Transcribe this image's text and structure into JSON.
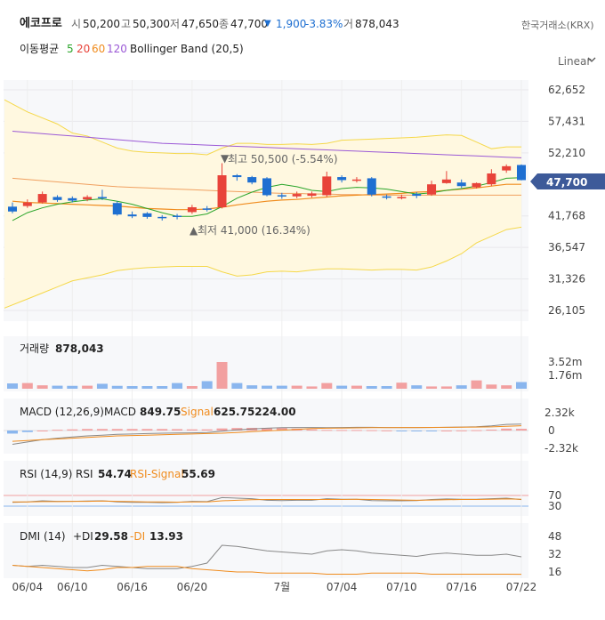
{
  "header": {
    "stock_name": "에코프로",
    "open_label": "시",
    "open": "50,200",
    "high_label": "고",
    "high": "50,300",
    "low_label": "저",
    "low": "47,650",
    "close_label": "종",
    "close": "47,700",
    "change_arrow": "▼",
    "change": "1,900",
    "change_pct": "-3.83%",
    "volume_label": "거",
    "volume": "878,043",
    "exchange": "한국거래소(KRX)",
    "scale_mode": "Linear",
    "ma_label": "이동평균",
    "ma5": "5",
    "ma20": "20",
    "ma60": "60",
    "ma120": "120",
    "bb_label": "Bollinger Band (20,5)"
  },
  "colors": {
    "up": "#e8433a",
    "down": "#1e6fd1",
    "ma5": "#2aa52a",
    "ma20": "#f08c1e",
    "ma60": "#f0a060",
    "ma120": "#9b59d6",
    "bb_line": "#f5d84a",
    "bb_fill": "#fff8e0",
    "price_tag": "#3d5a99",
    "rsi_line": "#888888",
    "dip": "#888888",
    "dim": "#f08c1e"
  },
  "price_panel": {
    "y_ticks": [
      "62,652",
      "57,431",
      "52,210",
      "47,700",
      "41,768",
      "36,547",
      "31,326",
      "26,105"
    ],
    "current_price": "47,700",
    "high_annotation": "최고 50,500 (-5.54%)",
    "low_annotation": "최저 41,000 (16.34%)"
  },
  "volume_panel": {
    "title": "거래량",
    "value": "878,043",
    "y_ticks": [
      "3.52m",
      "1.76m"
    ]
  },
  "macd_panel": {
    "title": "MACD (12,26,9)",
    "macd_label": "MACD",
    "macd_value": "849.75",
    "signal_label": "Signal",
    "signal_value": "625.75224.00",
    "y_ticks": [
      "2.32k",
      "0",
      "-2.32k"
    ]
  },
  "rsi_panel": {
    "title": "RSI (14,9)",
    "rsi_label": "RSI",
    "rsi_value": "54.74",
    "signal_label": "RSI-Signal",
    "signal_value": "55.69",
    "y_ticks": [
      "70",
      "30"
    ]
  },
  "dmi_panel": {
    "title": "DMI (14)",
    "dip_label": "+DI",
    "dip_value": "29.58",
    "dim_label": "-DI",
    "dim_value": "13.93",
    "y_ticks": [
      "48",
      "32",
      "16"
    ]
  },
  "x_ticks": [
    "06/04",
    "06/10",
    "06/16",
    "06/20",
    "7월",
    "07/04",
    "07/10",
    "07/16",
    "07/22"
  ],
  "chart_data": {
    "type": "candlestick",
    "dates": [
      "06/03",
      "06/04",
      "06/05",
      "06/07",
      "06/10",
      "06/11",
      "06/12",
      "06/13",
      "06/14",
      "06/17",
      "06/18",
      "06/19",
      "06/20",
      "06/21",
      "06/24",
      "06/25",
      "06/26",
      "06/27",
      "06/28",
      "07/01",
      "07/02",
      "07/03",
      "07/04",
      "07/05",
      "07/08",
      "07/09",
      "07/10",
      "07/11",
      "07/12",
      "07/15",
      "07/16",
      "07/17",
      "07/18",
      "07/19",
      "07/22"
    ],
    "open": [
      43300,
      43400,
      44000,
      44900,
      44700,
      44500,
      44900,
      43900,
      42000,
      42200,
      41600,
      41800,
      42400,
      43000,
      43200,
      48500,
      48200,
      48000,
      45200,
      45000,
      45100,
      45200,
      48200,
      47700,
      48000,
      45000,
      44800,
      45400,
      45300,
      47200,
      47300,
      46500,
      47000,
      49300,
      50200
    ],
    "close": [
      42500,
      44000,
      45400,
      44400,
      44300,
      44900,
      44800,
      42000,
      41700,
      41600,
      41400,
      41600,
      43200,
      42800,
      48500,
      48200,
      47300,
      45200,
      45000,
      45400,
      45500,
      48300,
      47700,
      47800,
      45300,
      44900,
      44900,
      45100,
      47000,
      47800,
      46700,
      47200,
      48800,
      50000,
      47700
    ],
    "high": [
      44000,
      44500,
      45800,
      45200,
      45000,
      45200,
      46100,
      44200,
      42500,
      42400,
      41900,
      42100,
      43600,
      43400,
      50500,
      48700,
      48400,
      48200,
      45600,
      45800,
      45800,
      49100,
      48500,
      48200,
      48200,
      45300,
      45300,
      45700,
      47600,
      49200,
      47800,
      47300,
      49500,
      50300,
      50300
    ],
    "low": [
      42200,
      43100,
      43800,
      44100,
      44000,
      44200,
      44400,
      41800,
      41400,
      41300,
      41000,
      41200,
      42100,
      42500,
      43000,
      47600,
      47000,
      45000,
      44600,
      44700,
      44800,
      44900,
      47300,
      47300,
      45000,
      44500,
      44500,
      44700,
      45100,
      47100,
      46400,
      46300,
      46700,
      48900,
      47650
    ],
    "volume": [
      0.7,
      0.75,
      0.45,
      0.4,
      0.38,
      0.4,
      0.65,
      0.38,
      0.35,
      0.35,
      0.35,
      0.75,
      0.35,
      1.0,
      3.52,
      0.75,
      0.45,
      0.4,
      0.4,
      0.4,
      0.3,
      0.75,
      0.4,
      0.4,
      0.35,
      0.35,
      0.8,
      0.45,
      0.3,
      0.3,
      0.45,
      1.1,
      0.55,
      0.45,
      0.88
    ],
    "volume_unit": "m",
    "ma5": [
      41000,
      42300,
      43100,
      43700,
      44100,
      44400,
      44600,
      44200,
      43700,
      43000,
      42300,
      41700,
      41700,
      42100,
      43300,
      44700,
      45700,
      46500,
      47000,
      46600,
      46000,
      45800,
      46300,
      46500,
      46400,
      46200,
      45800,
      45400,
      45600,
      46000,
      46300,
      46700,
      47300,
      48000,
      48100
    ],
    "ma20": [
      44200,
      44000,
      43900,
      43800,
      43700,
      43600,
      43500,
      43400,
      43200,
      43000,
      42900,
      42800,
      42800,
      42900,
      43200,
      43600,
      43900,
      44200,
      44400,
      44500,
      44700,
      44900,
      45100,
      45200,
      45300,
      45400,
      45500,
      45700,
      45800,
      46000,
      46200,
      46400,
      46700,
      47000,
      47000
    ],
    "ma60": [
      48000,
      47800,
      47600,
      47400,
      47200,
      47000,
      46800,
      46600,
      46500,
      46400,
      46300,
      46200,
      46100,
      46000,
      45900,
      45800,
      45700,
      45600,
      45500,
      45500,
      45400,
      45400,
      45300,
      45300,
      45200,
      45200,
      45200,
      45200,
      45200,
      45200,
      45200,
      45200,
      45200,
      45200,
      45200
    ],
    "ma120": [
      55800,
      55600,
      55400,
      55200,
      55000,
      54800,
      54600,
      54400,
      54200,
      54000,
      53800,
      53700,
      53600,
      53500,
      53400,
      53300,
      53200,
      53100,
      53000,
      52900,
      52800,
      52700,
      52600,
      52500,
      52400,
      52300,
      52200,
      52100,
      52000,
      51900,
      51800,
      51700,
      51600,
      51500,
      51400
    ],
    "bb_upper": [
      61000,
      59000,
      58000,
      57000,
      55500,
      55000,
      54000,
      53000,
      52500,
      52300,
      52200,
      52100,
      52100,
      51900,
      53000,
      53800,
      53800,
      53600,
      53600,
      53700,
      53600,
      53800,
      54300,
      54400,
      54500,
      54600,
      54700,
      54800,
      55000,
      55200,
      55100,
      54000,
      52900,
      53200,
      53200
    ],
    "bb_lower": [
      26500,
      28000,
      29000,
      30000,
      31000,
      31500,
      32000,
      32700,
      33000,
      33200,
      33300,
      33400,
      33400,
      33400,
      32500,
      31800,
      32000,
      32500,
      32600,
      32500,
      32800,
      33000,
      33000,
      32900,
      32800,
      32900,
      32900,
      32800,
      33300,
      34300,
      35500,
      37300,
      38400,
      39500,
      39900
    ],
    "macd": [
      -1800,
      -1500,
      -1200,
      -1000,
      -850,
      -700,
      -600,
      -500,
      -450,
      -400,
      -350,
      -320,
      -300,
      -250,
      -80,
      80,
      200,
      300,
      380,
      400,
      400,
      380,
      400,
      420,
      420,
      400,
      380,
      380,
      390,
      420,
      450,
      500,
      600,
      800,
      850
    ],
    "macd_signal": [
      -1400,
      -1300,
      -1200,
      -1100,
      -1000,
      -900,
      -800,
      -700,
      -650,
      -600,
      -550,
      -500,
      -450,
      -400,
      -350,
      -250,
      -150,
      -50,
      50,
      150,
      250,
      300,
      330,
      350,
      370,
      380,
      390,
      400,
      410,
      420,
      430,
      450,
      480,
      550,
      625
    ],
    "rsi": [
      44,
      46,
      50,
      48,
      48,
      49,
      50,
      46,
      44,
      44,
      43,
      44,
      48,
      47,
      62,
      60,
      58,
      52,
      51,
      52,
      52,
      58,
      56,
      56,
      51,
      50,
      50,
      51,
      55,
      57,
      56,
      56,
      58,
      60,
      54.74
    ],
    "rsi_signal": [
      46,
      46,
      47,
      47,
      48,
      48,
      49,
      48,
      47,
      46,
      46,
      45,
      46,
      46,
      50,
      52,
      54,
      55,
      55,
      55,
      55,
      55,
      55,
      56,
      55,
      54,
      53,
      52,
      53,
      54,
      55,
      55,
      56,
      57,
      55.69
    ],
    "dmi_plus": [
      22,
      21,
      22,
      21,
      20,
      20,
      22,
      21,
      20,
      19,
      19,
      19,
      21,
      24,
      40,
      39,
      37,
      35,
      34,
      33,
      32,
      35,
      36,
      35,
      33,
      32,
      31,
      30,
      32,
      33,
      32,
      31,
      31,
      32,
      29.58
    ],
    "dmi_minus": [
      22,
      21,
      20,
      19,
      18,
      17,
      18,
      20,
      20,
      21,
      21,
      21,
      19,
      18,
      17,
      16,
      16,
      15,
      15,
      15,
      15,
      14,
      14,
      14,
      15,
      15,
      15,
      15,
      14,
      14,
      14,
      14,
      14,
      14,
      13.93
    ]
  }
}
